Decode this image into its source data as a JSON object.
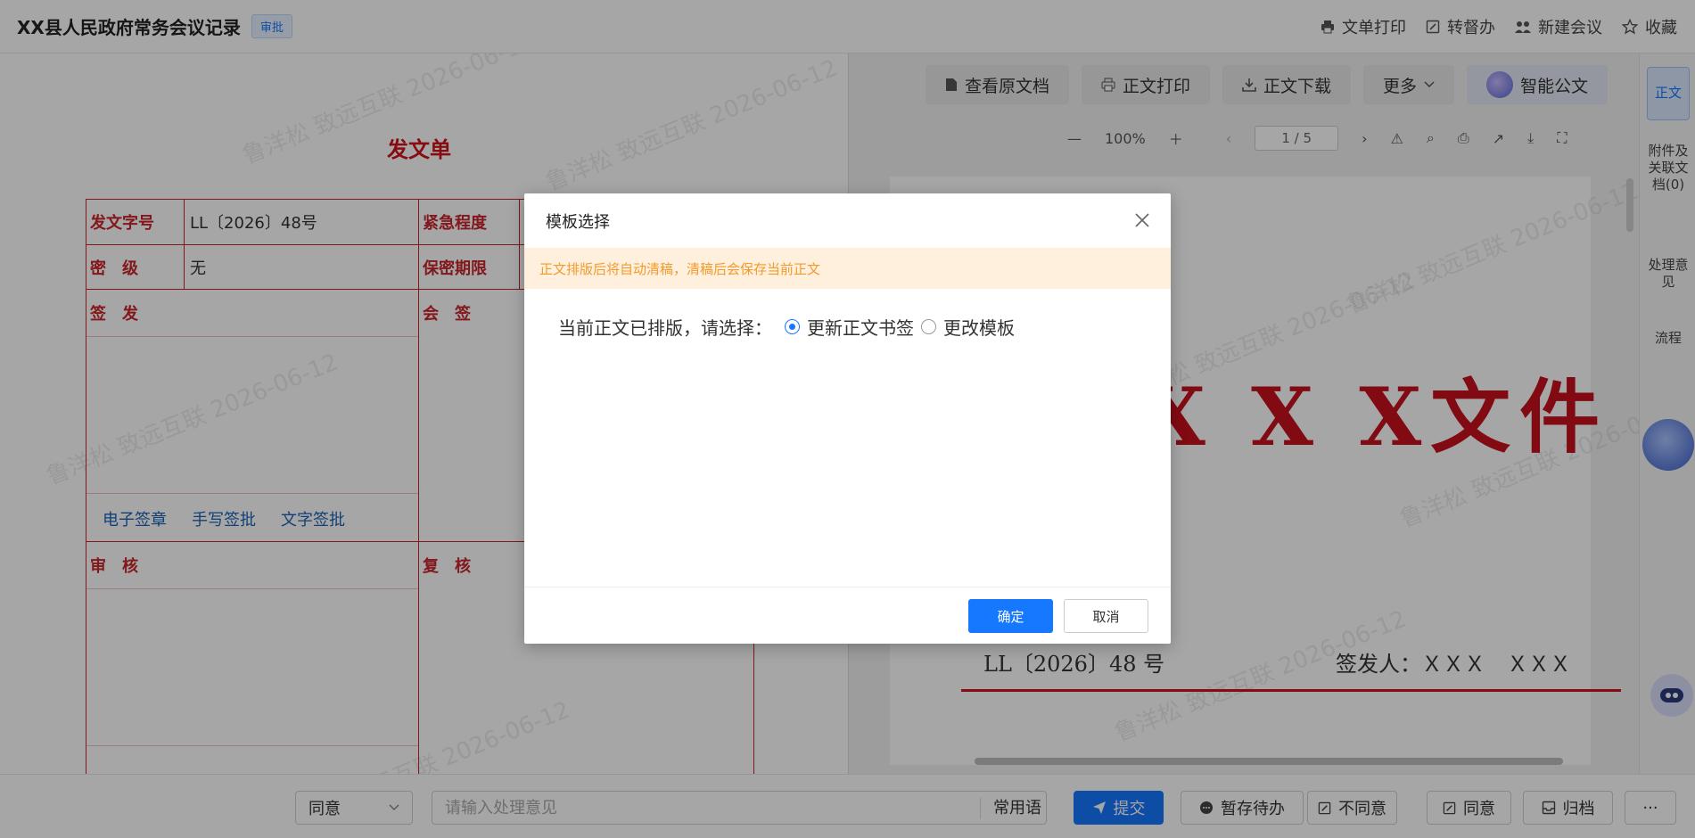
{
  "header": {
    "title": "XX县人民政府常务会议记录",
    "badge": "审批",
    "actions": [
      {
        "label": "文单打印",
        "icon": "printer-icon"
      },
      {
        "label": "转督办",
        "icon": "edit-icon"
      },
      {
        "label": "新建会议",
        "icon": "meeting-icon"
      },
      {
        "label": "收藏",
        "icon": "star-icon"
      }
    ]
  },
  "form": {
    "title": "发文单",
    "doc_number_label": "发文字号",
    "doc_number_value": "LL〔2026〕48号",
    "urgency_label": "紧急程度",
    "secret_label": "密　级",
    "secret_value": "无",
    "secret_period_label": "保密期限",
    "sign_label": "签　发",
    "countersign_label": "会　签",
    "review_label": "审　核",
    "recheck_label": "复　核",
    "sig_links": [
      "电子签章",
      "手写签批",
      "文字签批"
    ],
    "watermark": "鲁洋松  致远互联  2026-06-12"
  },
  "viewer": {
    "buttons": [
      "查看原文档",
      "正文打印",
      "正文下载",
      "更多",
      "智能公文"
    ],
    "zoom": "100%",
    "page_indicator": "1 / 5",
    "doc_heading": "X X X文件",
    "doc_number": "LL〔2026〕48 号",
    "doc_issuer": "签发人：ＸＸＸ　ＸＸＸ"
  },
  "side_tabs": [
    {
      "label": "正文",
      "active": true
    },
    {
      "label": "附件及关联文档(0)",
      "active": false
    },
    {
      "label": "处理意见",
      "active": false
    },
    {
      "label": "流程",
      "active": false
    }
  ],
  "bottom": {
    "opinion_select": "同意",
    "opinion_placeholder": "请输入处理意见",
    "common_phrases": "常用语",
    "submit": "提交",
    "save_pending": "暂存待办",
    "disagree": "不同意",
    "agree": "同意",
    "archive": "归档",
    "more": "···"
  },
  "modal": {
    "title": "模板选择",
    "warning": "正文排版后将自动清稿，清稿后会保存当前正文",
    "prompt": "当前正文已排版，请选择：",
    "option_update": "更新正文书签",
    "option_change": "更改模板",
    "selected": "更新正文书签",
    "ok": "确定",
    "cancel": "取消"
  },
  "colors": {
    "accent": "#1677ff",
    "red": "#c8242c",
    "warning": "#f39a2b"
  }
}
